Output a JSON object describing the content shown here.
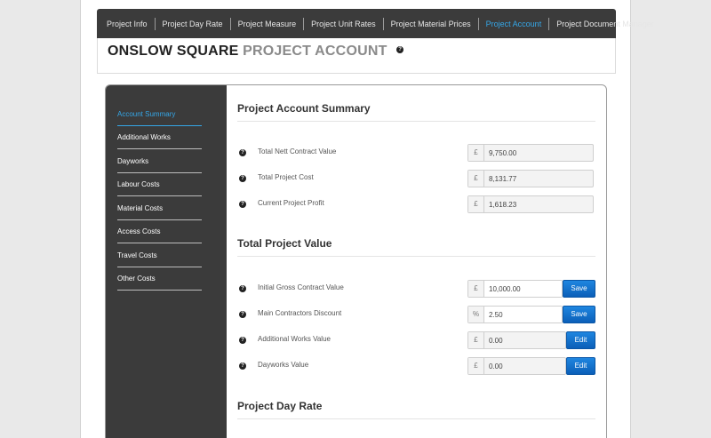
{
  "nav": {
    "tabs": [
      {
        "label": "Project Info"
      },
      {
        "label": "Project Day Rate"
      },
      {
        "label": "Project Measure"
      },
      {
        "label": "Project Unit Rates"
      },
      {
        "label": "Project Material Prices"
      },
      {
        "label": "Project Account",
        "active": true
      },
      {
        "label": "Project Document Manager"
      }
    ]
  },
  "header": {
    "title_main": "ONSLOW SQUARE",
    "title_sub": "PROJECT ACCOUNT",
    "help_glyph": "?"
  },
  "sidebar": {
    "items": [
      {
        "label": "Account Summary",
        "active": true
      },
      {
        "label": "Additional Works"
      },
      {
        "label": "Dayworks"
      },
      {
        "label": "Labour Costs"
      },
      {
        "label": "Material Costs"
      },
      {
        "label": "Access Costs"
      },
      {
        "label": "Travel Costs"
      },
      {
        "label": "Other Costs"
      }
    ]
  },
  "summary": {
    "title": "Project Account Summary",
    "rows": [
      {
        "label": "Total Nett Contract Value",
        "unit": "£",
        "value": "9,750.00"
      },
      {
        "label": "Total Project Cost",
        "unit": "£",
        "value": "8,131.77"
      },
      {
        "label": "Current Project Profit",
        "unit": "£",
        "value": "1,618.23"
      }
    ]
  },
  "project_value": {
    "title": "Total Project Value",
    "rows": [
      {
        "label": "Initial Gross Contract Value",
        "unit": "£",
        "value": "10,000.00",
        "button": "Save"
      },
      {
        "label": "Main Contractors Discount",
        "unit": "%",
        "value": "2.50",
        "button": "Save"
      },
      {
        "label": "Additional Works Value",
        "unit": "£",
        "value": "0.00",
        "button": "Edit"
      },
      {
        "label": "Dayworks Value",
        "unit": "£",
        "value": "0.00",
        "button": "Edit"
      }
    ]
  },
  "day_rate": {
    "title": "Project Day Rate"
  },
  "colors": {
    "accent": "#35a7e8",
    "dark_bar": "#3b3b3b",
    "button": "#0b6fd0"
  },
  "icons": {
    "help": "question-circle-icon"
  }
}
